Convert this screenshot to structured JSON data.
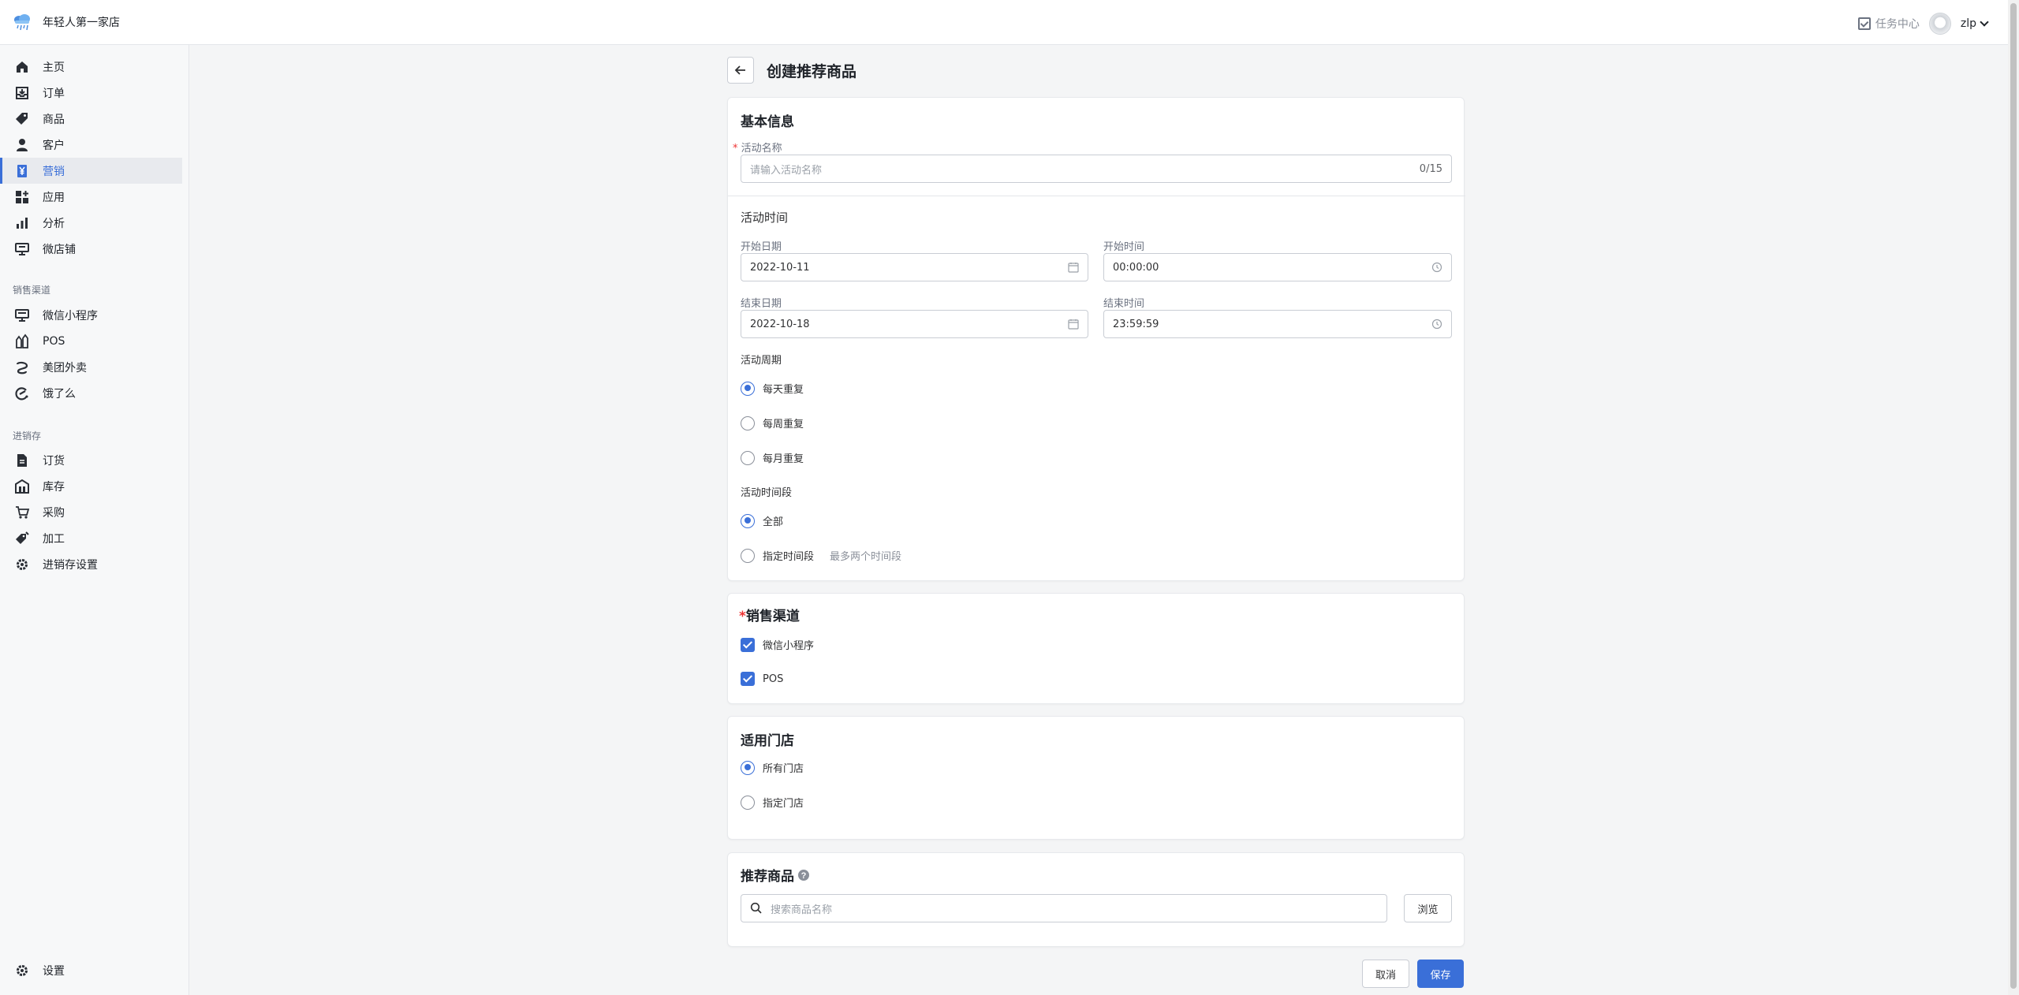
{
  "app": {
    "store_name": "年轻人第一家店"
  },
  "topbar": {
    "task_center": "任务中心",
    "user": "zlp"
  },
  "sidebar": {
    "main": [
      {
        "label": "主页",
        "icon": "home-icon"
      },
      {
        "label": "订单",
        "icon": "order-icon"
      },
      {
        "label": "商品",
        "icon": "tag-icon"
      },
      {
        "label": "客户",
        "icon": "person-icon"
      },
      {
        "label": "营销",
        "icon": "yen-icon",
        "active": true
      },
      {
        "label": "应用",
        "icon": "apps-icon"
      },
      {
        "label": "分析",
        "icon": "bar-chart-icon"
      },
      {
        "label": "微店铺",
        "icon": "storefront-icon"
      }
    ],
    "sales_title": "销售渠道",
    "sales": [
      {
        "label": "微信小程序",
        "icon": "monitor-icon"
      },
      {
        "label": "POS",
        "icon": "pos-icon"
      },
      {
        "label": "美团外卖",
        "icon": "meituan-icon"
      },
      {
        "label": "饿了么",
        "icon": "eleme-icon"
      }
    ],
    "inventory_title": "进销存",
    "inventory": [
      {
        "label": "订货",
        "icon": "document-icon"
      },
      {
        "label": "库存",
        "icon": "warehouse-icon"
      },
      {
        "label": "采购",
        "icon": "cart-icon"
      },
      {
        "label": "加工",
        "icon": "process-tag-icon"
      },
      {
        "label": "进销存设置",
        "icon": "gear-icon"
      }
    ],
    "settings": {
      "label": "设置",
      "icon": "gear-icon"
    }
  },
  "page": {
    "title": "创建推荐商品"
  },
  "basic": {
    "title": "基本信息",
    "name_label": "活动名称",
    "name_placeholder": "请输入活动名称",
    "name_counter": "0/15",
    "time_title": "活动时间",
    "start_date_label": "开始日期",
    "start_date": "2022-10-11",
    "start_time_label": "开始时间",
    "start_time": "00:00:00",
    "end_date_label": "结束日期",
    "end_date": "2022-10-18",
    "end_time_label": "结束时间",
    "end_time": "23:59:59",
    "cycle_title": "活动周期",
    "cycle_options": [
      "每天重复",
      "每周重复",
      "每月重复"
    ],
    "period_title": "活动时间段",
    "period_all": "全部",
    "period_custom": "指定时间段",
    "period_hint": "最多两个时间段"
  },
  "channels": {
    "title": "销售渠道",
    "options": [
      "微信小程序",
      "POS"
    ]
  },
  "stores": {
    "title": "适用门店",
    "options": [
      "所有门店",
      "指定门店"
    ]
  },
  "products": {
    "title": "推荐商品",
    "search_placeholder": "搜索商品名称",
    "browse": "浏览"
  },
  "footer": {
    "cancel": "取消",
    "save": "保存"
  },
  "colors": {
    "primary": "#3a6fd8",
    "required": "#ee3333"
  }
}
